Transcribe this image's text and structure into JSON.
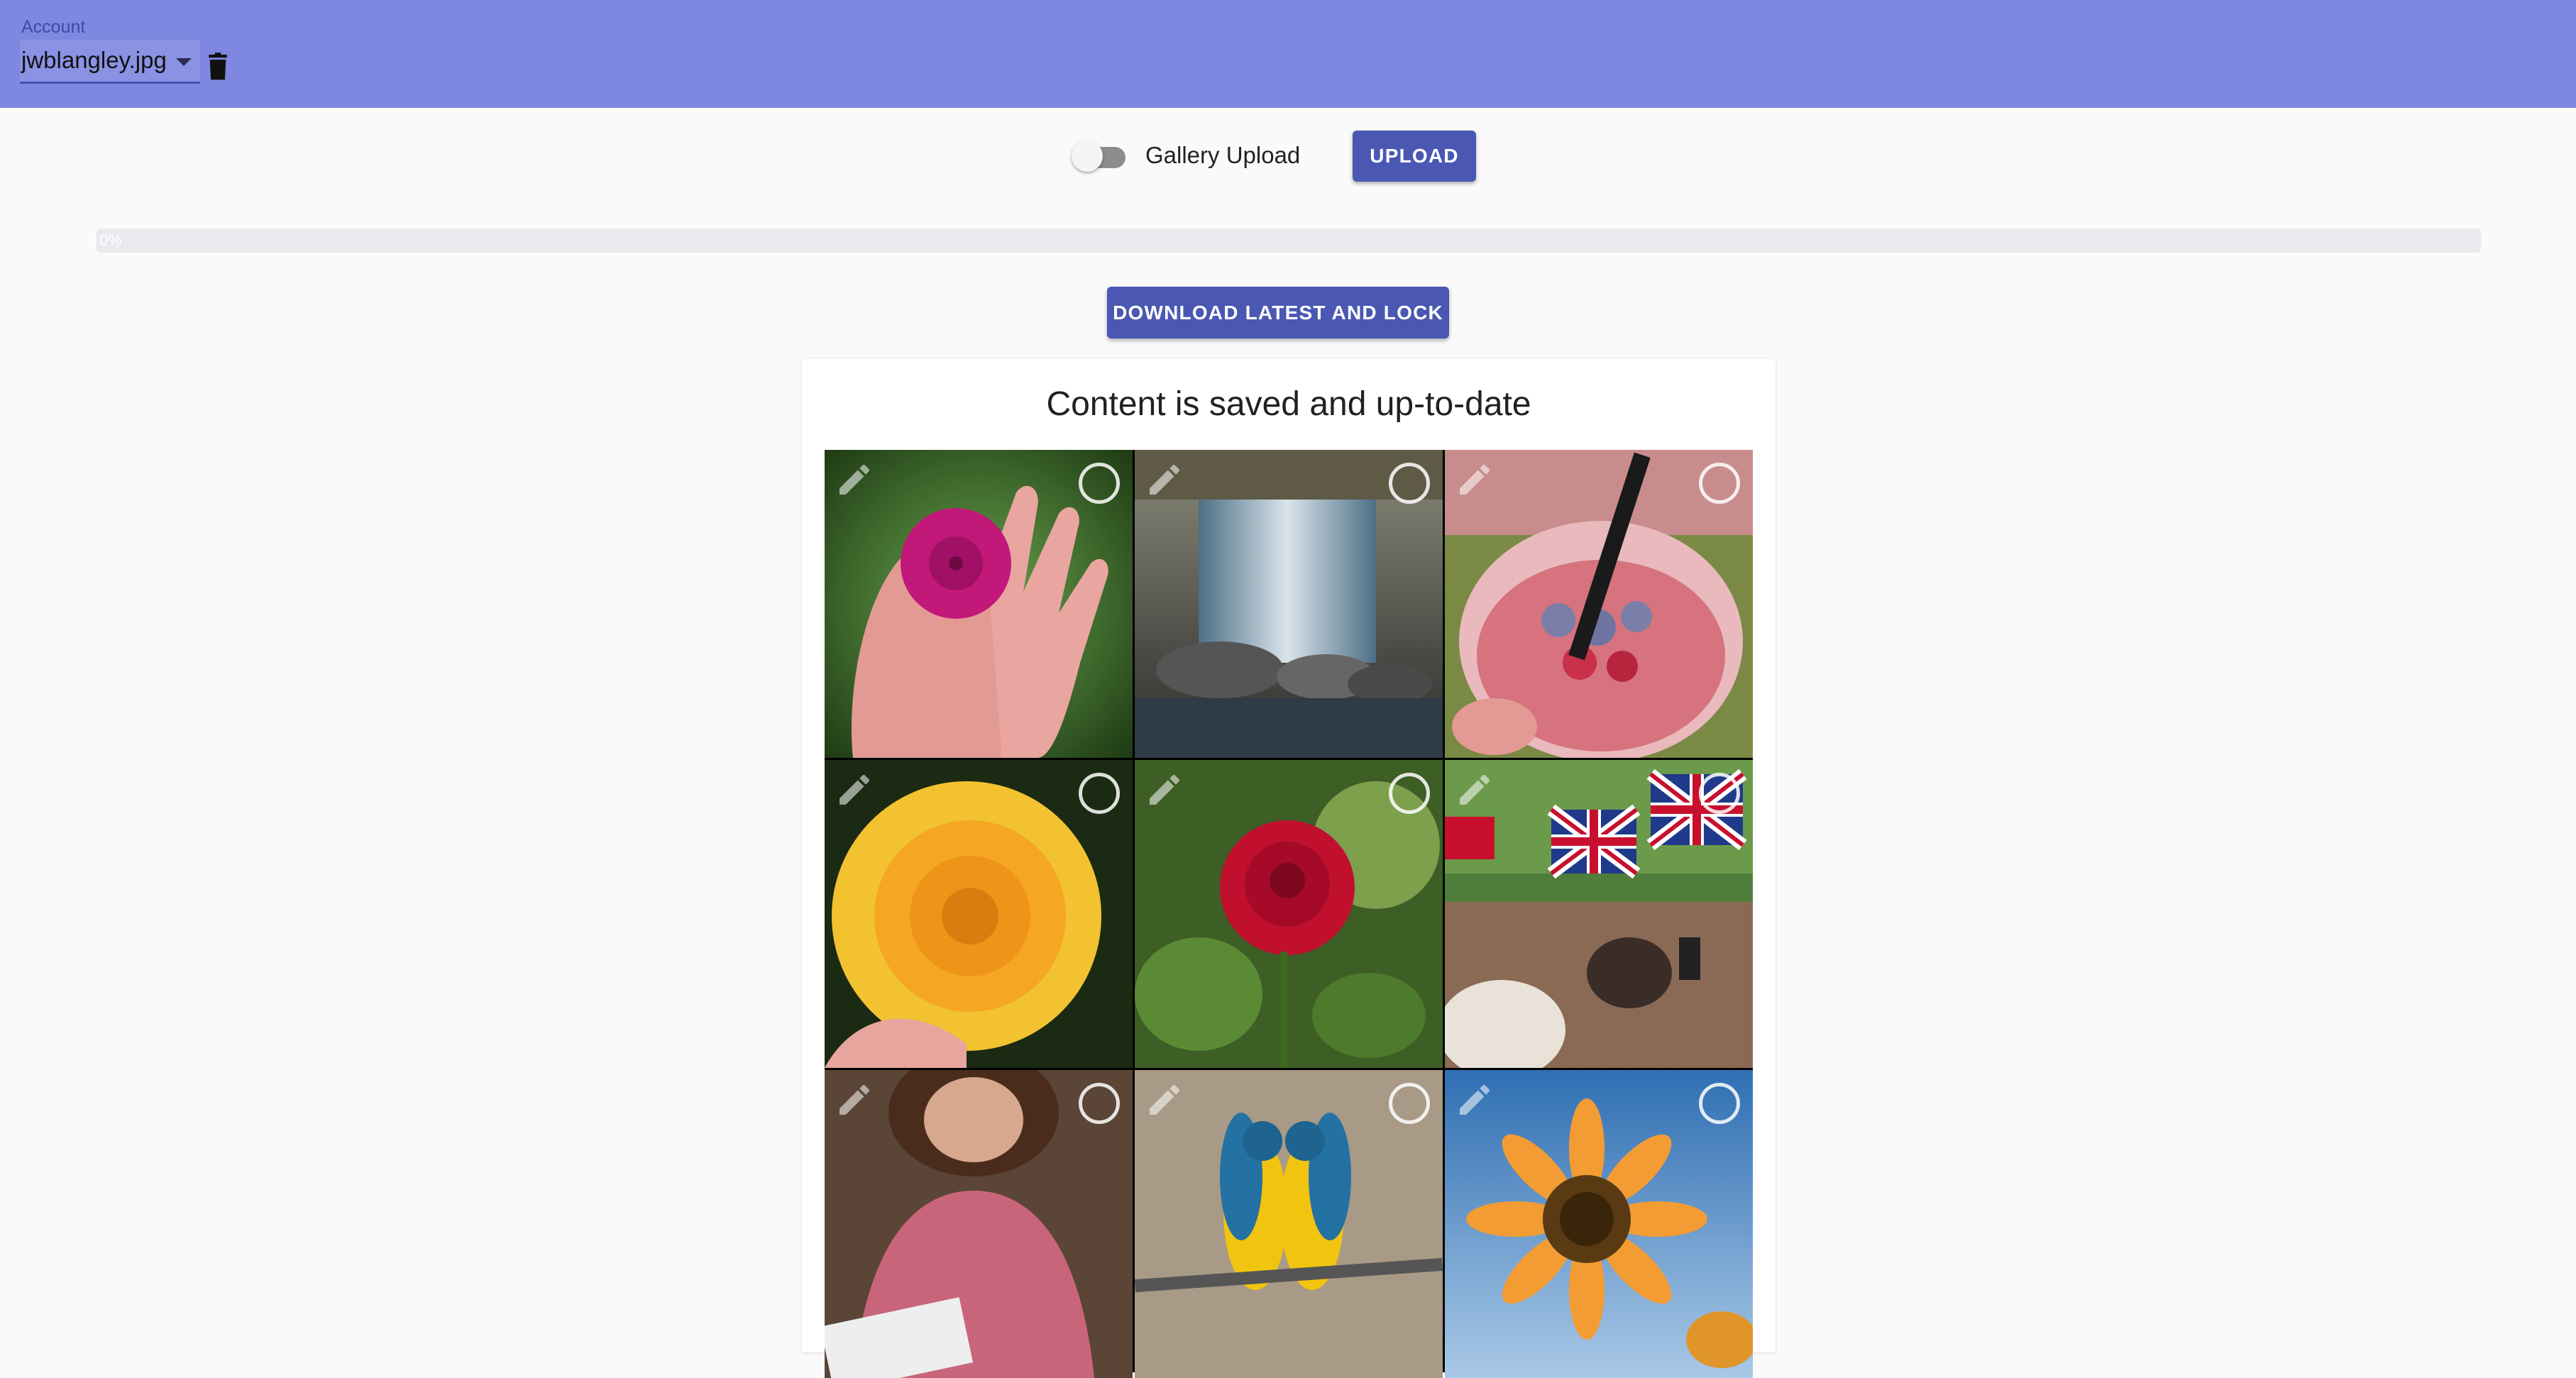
{
  "header": {
    "account_label": "Account",
    "account_value": "jwblangley.jpg",
    "delete_icon": "trash-icon",
    "background": "#7f88e0"
  },
  "upload_row": {
    "toggle_label": "Gallery Upload",
    "toggle_on": false,
    "upload_label": "UPLOAD"
  },
  "progress": {
    "percent": 0,
    "text": "0%"
  },
  "download_label": "DOWNLOAD LATEST AND LOCK",
  "content": {
    "status_title": "Content is saved and up-to-date",
    "tiles": [
      {
        "subject": "pink flower on palm",
        "edit_icon": "pencil-icon",
        "select_icon": "circle-outline-icon"
      },
      {
        "subject": "waterfall",
        "edit_icon": "pencil-icon",
        "select_icon": "circle-outline-icon"
      },
      {
        "subject": "pink drink with straw",
        "edit_icon": "pencil-icon",
        "select_icon": "circle-outline-icon"
      },
      {
        "subject": "yellow rose",
        "edit_icon": "pencil-icon",
        "select_icon": "circle-outline-icon"
      },
      {
        "subject": "red rose",
        "edit_icon": "pencil-icon",
        "select_icon": "circle-outline-icon"
      },
      {
        "subject": "crowd with union flags",
        "edit_icon": "pencil-icon",
        "select_icon": "circle-outline-icon"
      },
      {
        "subject": "woman reading",
        "edit_icon": "pencil-icon",
        "select_icon": "circle-outline-icon"
      },
      {
        "subject": "two macaws",
        "edit_icon": "pencil-icon",
        "select_icon": "circle-outline-icon"
      },
      {
        "subject": "sunflower",
        "edit_icon": "pencil-icon",
        "select_icon": "circle-outline-icon"
      }
    ]
  },
  "colors": {
    "primary": "#4a58b3",
    "appbar": "#7f88e0",
    "background": "#fafafa"
  }
}
